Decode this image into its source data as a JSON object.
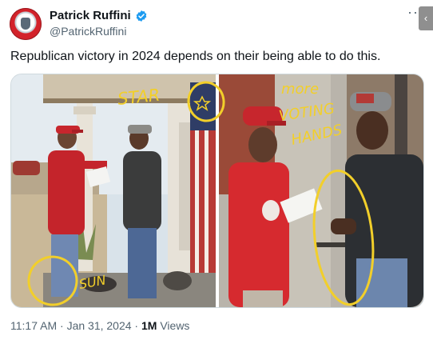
{
  "author": {
    "display_name": "Patrick Ruffini",
    "handle": "@PatrickRuffini",
    "verified": true,
    "avatar_icon": "seal-avatar-icon"
  },
  "menu_icon": "more-horizontal-icon",
  "tweet": {
    "text": "Republican victory in 2024 depends on their being able to do this."
  },
  "image_annotations": {
    "star": "STAR",
    "more": "more",
    "voting": "VOTING",
    "hands": "HANDS",
    "sun": "SUN"
  },
  "meta": {
    "time": "11:17 AM",
    "separator1": " · ",
    "date": "Jan 31, 2024",
    "separator2": " · ",
    "views_count": "1M",
    "views_label": " Views"
  },
  "colors": {
    "verified_blue": "#1d9bf0",
    "annotation_yellow": "#f2cf2a",
    "maga_red": "#d3222a"
  }
}
